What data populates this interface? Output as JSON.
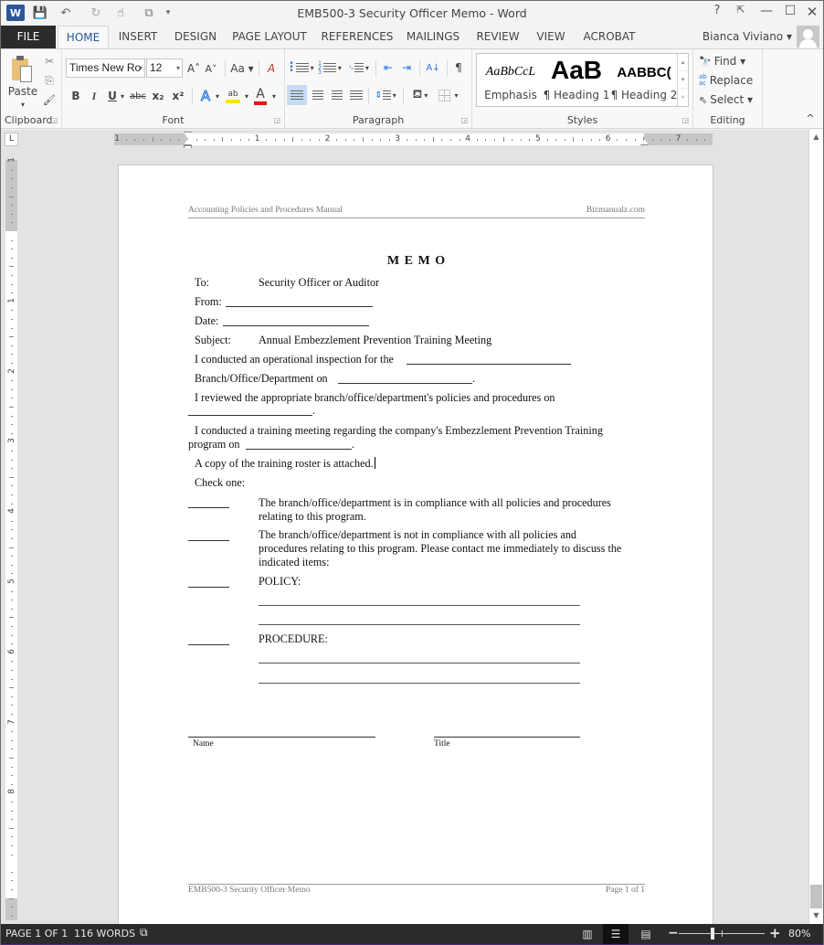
{
  "window": {
    "title": "EMB500-3 Security Officer Memo - Word",
    "help": "?",
    "controls": {
      "ribbon_display": "⇱",
      "minimize": "—",
      "maximize": "☐",
      "close": "✕"
    }
  },
  "quick_access": {
    "app_icon": "W",
    "save_icon": "💾",
    "undo_icon": "↶",
    "redo_icon": "↻",
    "touch_icon": "☝",
    "customize_icon": "▾"
  },
  "tabs": [
    {
      "label": "FILE"
    },
    {
      "label": "HOME",
      "active": true
    },
    {
      "label": "INSERT"
    },
    {
      "label": "DESIGN"
    },
    {
      "label": "PAGE LAYOUT"
    },
    {
      "label": "REFERENCES"
    },
    {
      "label": "MAILINGS"
    },
    {
      "label": "REVIEW"
    },
    {
      "label": "VIEW"
    },
    {
      "label": "ACROBAT"
    }
  ],
  "user": {
    "name": "Bianca Viviano ▾"
  },
  "ribbon": {
    "clipboard": {
      "label": "Clipboard",
      "paste": "Paste",
      "paste_arrow": "▾",
      "cut": "✂",
      "copy": "⎘",
      "format_painter": "🖌"
    },
    "font": {
      "label": "Font",
      "font_name": "Times New Ro",
      "font_size": "12",
      "grow": "A˄",
      "shrink": "A˅",
      "change_case": "Aa ▾",
      "clear_format": "A",
      "bold": "B",
      "italic": "I",
      "underline": "U",
      "strikethrough": "abc",
      "subscript": "x₂",
      "superscript": "x²",
      "text_effects": "A",
      "highlight": "ab",
      "font_color": "A",
      "highlight_color": "#f5e600",
      "font_color_value": "#e0161a"
    },
    "paragraph": {
      "label": "Paragraph",
      "sort": "A↓",
      "pilcrow": "¶"
    },
    "styles": {
      "label": "Styles",
      "items": [
        {
          "preview": "AaBbCcL",
          "name": "Emphasis"
        },
        {
          "preview": "AaB",
          "name": "¶ Heading 1"
        },
        {
          "preview": "AABBC(",
          "name": "¶ Heading 2"
        }
      ]
    },
    "editing": {
      "label": "Editing",
      "find": "Find ▾",
      "replace": "Replace",
      "select": "Select ▾",
      "collapse": "^"
    }
  },
  "ruler": {
    "tab_selector": "L",
    "h_numbers": [
      "1",
      "1",
      "2",
      "3",
      "4",
      "5",
      "6",
      "7"
    ],
    "v_numbers": [
      "1",
      "1",
      "2",
      "3",
      "4",
      "5",
      "6",
      "7",
      "8"
    ]
  },
  "document": {
    "header_left": "Accounting Policies and Procedures Manual",
    "header_right": "Bizmanualz.com",
    "title": "M E M O",
    "to_label": "To:",
    "to_value": "Security Officer or Auditor",
    "from_label": "From: ",
    "date_label": "Date: ",
    "subject_label": "Subject:",
    "subject_value": "Annual Embezzlement Prevention Training Meeting",
    "line_inspection": "I conducted an operational inspection for the ",
    "line_branch": "Branch/Office/Department on ",
    "line_reviewed": "I reviewed the appropriate branch/office/department's policies and procedures on",
    "line_meeting": "I conducted a training meeting regarding the company's Embezzlement Prevention     Training",
    "line_program": "program on ",
    "line_roster": "A copy of the training roster is attached.",
    "check_one": "Check one:",
    "option_compliant_1": "The branch/office/department is in compliance with all policies and procedures",
    "option_compliant_2": "relating to this program.",
    "option_noncompliant_1": "The branch/office/department is not in compliance with all policies and",
    "option_noncompliant_2": "procedures relating to this program.  Please contact me immediately to discuss the",
    "option_noncompliant_3": "indicated items:",
    "policy_label": "POLICY:",
    "procedure_label": "PROCEDURE:",
    "sig_name": "Name",
    "sig_title": "Title",
    "footer_left": "EMB500-3 Security Officer Memo",
    "footer_right": "Page 1 of 1"
  },
  "statusbar": {
    "page": "PAGE 1 OF 1",
    "words": "116 WORDS",
    "proof_icon": "📖",
    "read_mode": "📖",
    "print_layout": "☰",
    "web_layout": "🗔",
    "zoom_out": "−",
    "zoom_in": "+",
    "zoom_level": "80%",
    "zoom_percent": 80
  }
}
